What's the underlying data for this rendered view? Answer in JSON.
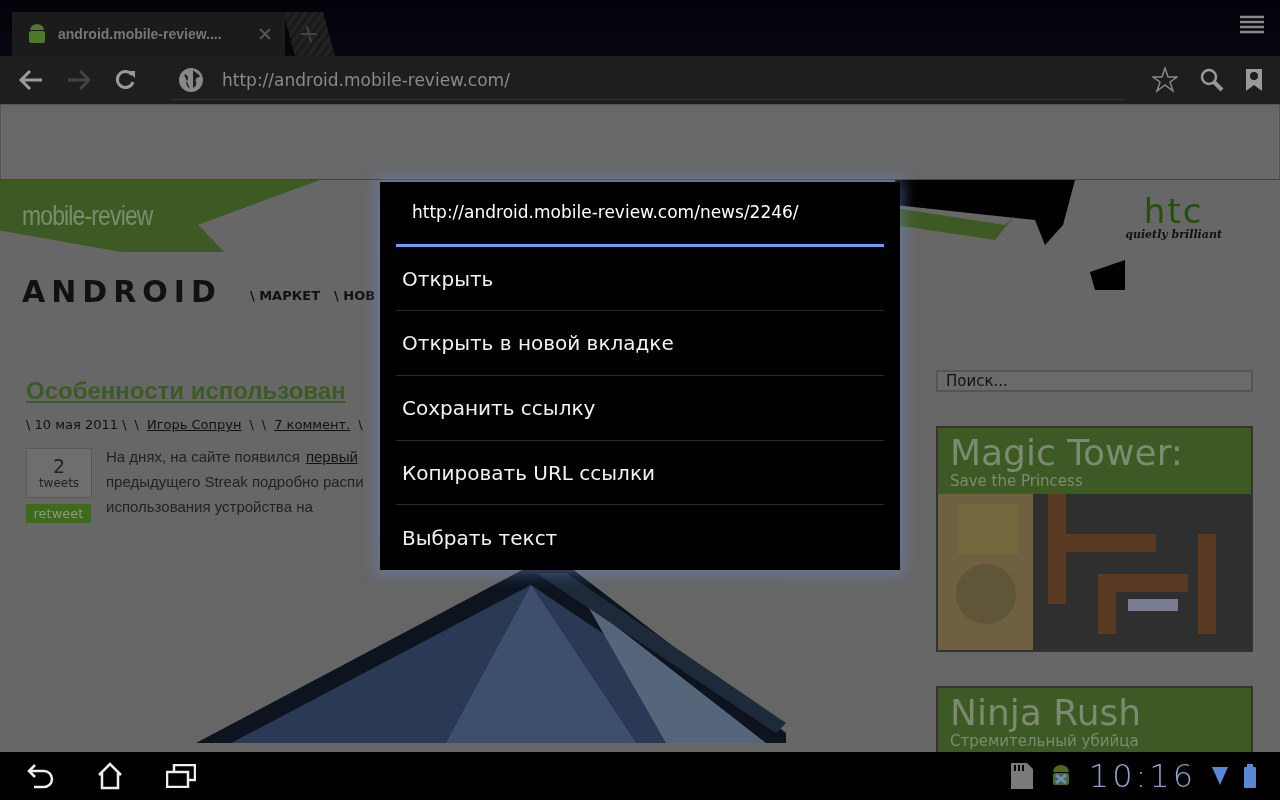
{
  "tabs": [
    {
      "title": "android.mobile-review....",
      "selected": true
    }
  ],
  "toolbar": {
    "url": "http://android.mobile-review.com/",
    "forward_disabled": true
  },
  "page": {
    "site_logo": "mobile-review",
    "android_logo": "ANDROID",
    "nav": [
      "\\ МАРКЕТ",
      "\\ НОВ"
    ],
    "banner_ad": {
      "brand": "htc",
      "slogan": "quietly brilliant"
    },
    "article": {
      "title": "Особенности использован",
      "meta": [
        {
          "kind": "text",
          "text": "\\ 10 мая 2011 \\"
        },
        {
          "kind": "text",
          "text": "\\"
        },
        {
          "kind": "link",
          "text": "Игорь Сопрун"
        },
        {
          "kind": "text",
          "text": "\\"
        },
        {
          "kind": "text",
          "text": "\\"
        },
        {
          "kind": "link",
          "text": "7 коммент."
        },
        {
          "kind": "text",
          "text": "\\"
        }
      ],
      "tweets": {
        "count": "2",
        "label": "tweets",
        "button": "retweet"
      },
      "lines": [
        [
          {
            "kind": "text",
            "text": "На днях, на сайте появился"
          },
          {
            "kind": "link",
            "text": "первый"
          }
        ],
        [
          {
            "kind": "text",
            "text": "предыдущего Streak подробно распи"
          }
        ],
        [
          {
            "kind": "text",
            "text": "использования устройства на"
          }
        ]
      ]
    },
    "search": {
      "placeholder": "Поиск..."
    },
    "ads": [
      {
        "title": "Magic Tower:",
        "subtitle": "Save the Princess",
        "kind": "picture"
      },
      {
        "title": "Ninja Rush",
        "subtitle": "Стремительный убийца"
      }
    ]
  },
  "dialog": {
    "title": "http://android.mobile-review.com/news/2246/",
    "items": [
      "Открыть",
      "Открыть в новой вкладке",
      "Сохранить ссылку",
      "Копировать URL ссылки",
      "Выбрать текст"
    ]
  },
  "system_bar": {
    "time": "10:16"
  }
}
